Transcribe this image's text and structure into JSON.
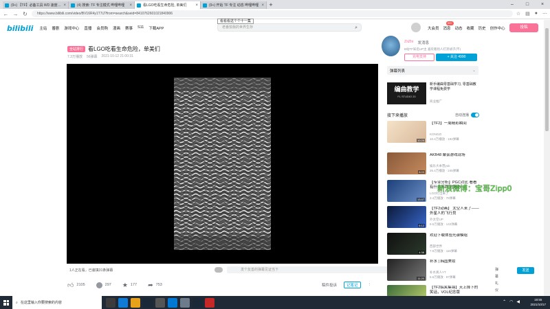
{
  "browser": {
    "tabs": [
      {
        "title": "(9+) 【TF】必备工具 WD 速度对比",
        "active": false
      },
      {
        "title": "(4) 搜索: TF 专注模式 哔哩哔哩",
        "active": false
      },
      {
        "title": "看LGO吃看生命危险, 单美们",
        "active": true
      },
      {
        "title": "(9+) 开始 TF 专注 动态 哔哩哔哩",
        "active": false
      }
    ],
    "new_tab": "+",
    "url": "https://www.bilibili.com/video/BV16R4y1T7iJ?from=search&seid=8410762601021840906",
    "tooltip": "看看看这个个十一集"
  },
  "header": {
    "logo": "bilibili",
    "nav": [
      "主站",
      "番剧",
      "游戏中心",
      "直播",
      "会员购",
      "漫画",
      "赛事",
      "S11",
      "下载APP"
    ],
    "search_placeholder": "老番茄我的世界生存",
    "right_nav": [
      "大会员",
      "消息",
      "动态",
      "收藏",
      "历史",
      "创作中心"
    ],
    "message_badge": "99+",
    "upload_label": "投稿"
  },
  "video": {
    "tag": "全站排行",
    "title": "看LGO吃看生命危险，单美们",
    "views": "7.3万播放",
    "danmaku": "56弹幕",
    "date": "2021-10-12 21:00:31"
  },
  "danmaku_bar": {
    "online": "1人正在看，已装填31条弹幕",
    "placeholder": "发个友善的弹幕见证当下",
    "etiquette": "弹幕礼仪 >",
    "send": "发送"
  },
  "actions": {
    "like": "2105",
    "coin": "297",
    "fav": "177",
    "share": "753",
    "report": "稿件投诉",
    "note": "记笔记"
  },
  "uploader": {
    "name": "ZiiZhi",
    "message": "发消息",
    "desc": "B站TF知名UP主 喜欢看别人打黑胡子(不)",
    "charge_label": "充电支持",
    "follow_label": "+ 关注 4990"
  },
  "danmaku_list": {
    "label": "弹幕列表"
  },
  "ad": {
    "title": "编曲教学",
    "subtitle": "FL STUDIO 20",
    "text": "新手编曲零基础学习, 零基础教学课程免费学",
    "tag": "商业推广"
  },
  "next": {
    "label": "接下来播放",
    "autoplay": "自动连播"
  },
  "recommendations": [
    {
      "title": "【TF2】一周精彩瞬间",
      "up": "KONGZI",
      "stats": "10.4万播放 · 192弹幕",
      "duration": "10:25"
    },
    {
      "title": "AKB48 聚会游戏现场",
      "up": "娱乐大本营yuk",
      "stats": "26.4万播放 · 245弹幕",
      "duration": "8:03"
    },
    {
      "title": "【专业分析】PGC对比 看看有什么不同 的地方",
      "up": "LGO打出来了",
      "stats": "3.4万播放 · 78弹幕",
      "duration": "13:47"
    },
    {
      "title": "【TF2动画】 太空人来了——外星人的飞行员",
      "up": "外太空UP",
      "stats": "9.5万播放 · 142弹幕",
      "duration": "6:12"
    },
    {
      "title": "欢迎下载体验光谱模组",
      "up": "西部世界",
      "stats": "7.9万播放 · 116弹幕",
      "duration": "4:38"
    },
    {
      "title": "补水 | 韩国美妆",
      "up": "补水真人YT",
      "stats": "5.6万播放 · 97弹幕",
      "duration": "11:20"
    },
    {
      "title": "【TF2搞笑集锦】天上掉下的笑话，VOL纪念版",
      "up": "",
      "stats": "",
      "duration": ""
    }
  ],
  "watermark": "新浪微博：宝哥Zipp0",
  "taskbar": {
    "search": "在这里输入你要搜索的内容",
    "time": "18:55",
    "date": "2021/10/17"
  }
}
